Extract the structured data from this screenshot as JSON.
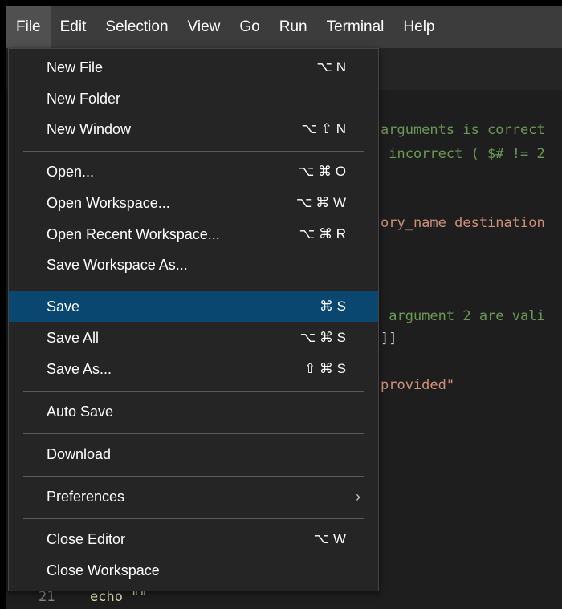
{
  "menubar": {
    "items": [
      "File",
      "Edit",
      "Selection",
      "View",
      "Go",
      "Run",
      "Terminal",
      "Help"
    ]
  },
  "code": {
    "line1": "arguments is correct",
    "line2": " incorrect ( $# != 2",
    "line3": "ory_name destination",
    "line4": " argument 2 are vali",
    "line5": "]]",
    "line6": "provided\"",
    "line_number": "21",
    "last_code": "echo \"\""
  },
  "file_menu": {
    "new_file": {
      "label": "New File",
      "shortcut": "⌥ N"
    },
    "new_folder": {
      "label": "New Folder"
    },
    "new_window": {
      "label": "New Window",
      "shortcut": "⌥ ⇧ N"
    },
    "open": {
      "label": "Open...",
      "shortcut": "⌥ ⌘ O"
    },
    "open_workspace": {
      "label": "Open Workspace...",
      "shortcut": "⌥ ⌘ W"
    },
    "open_recent_workspace": {
      "label": "Open Recent Workspace...",
      "shortcut": "⌥ ⌘ R"
    },
    "save_workspace_as": {
      "label": "Save Workspace As..."
    },
    "save": {
      "label": "Save",
      "shortcut": "⌘ S"
    },
    "save_all": {
      "label": "Save All",
      "shortcut": "⌥ ⌘ S"
    },
    "save_as": {
      "label": "Save As...",
      "shortcut": "⇧ ⌘ S"
    },
    "auto_save": {
      "label": "Auto Save"
    },
    "download": {
      "label": "Download"
    },
    "preferences": {
      "label": "Preferences",
      "chevron": "›"
    },
    "close_editor": {
      "label": "Close Editor",
      "shortcut": "⌥ W"
    },
    "close_workspace": {
      "label": "Close Workspace"
    }
  },
  "colors": {
    "menu_bg": "#252526",
    "highlight": "#094771",
    "menubar_bg": "#3c3c3c"
  }
}
